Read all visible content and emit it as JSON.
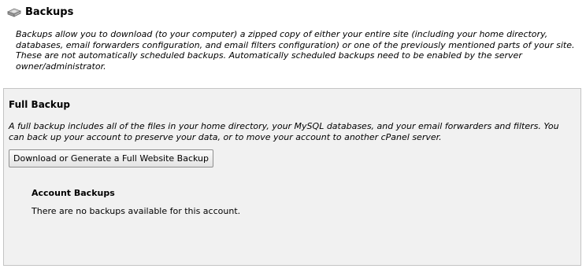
{
  "header": {
    "icon": "hard-drive-icon",
    "title": "Backups"
  },
  "intro": {
    "text": "Backups allow you to download (to your computer) a zipped copy of either your entire site (including your home directory, databases, email forwarders configuration, and email filters configuration) or one of the previously mentioned parts of your site. These are not automatically scheduled backups. Automatically scheduled backups need to be enabled by the server owner/administrator."
  },
  "full_backup": {
    "title": "Full Backup",
    "description": "A full backup includes all of the files in your home directory, your MySQL databases, and your email forwarders and filters. You can back up your account to preserve your data, or to move your account to another cPanel server.",
    "button_label": "Download or Generate a Full Website Backup",
    "account_backups_title": "Account Backups",
    "no_backups_text": "There are no backups available for this account."
  },
  "colors": {
    "panel_background": "#f1f1f1",
    "panel_border": "#c4c4c4"
  }
}
